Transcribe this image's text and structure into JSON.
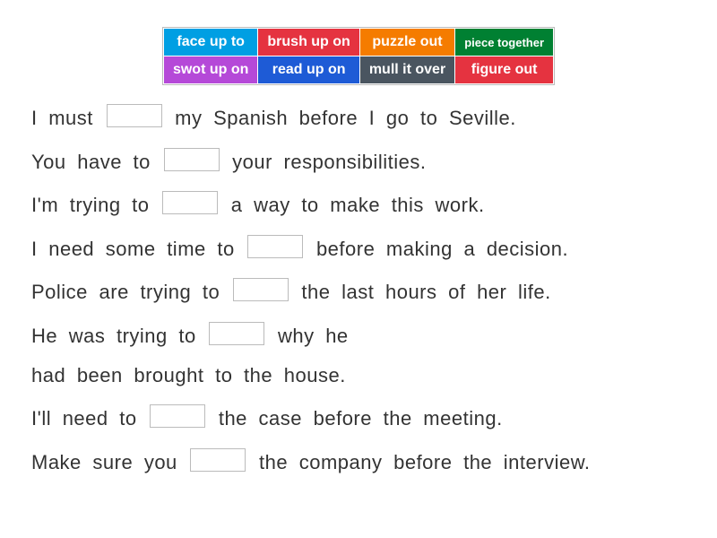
{
  "tiles": [
    {
      "label": "face up to",
      "bg": "#009fe3",
      "size": "normal"
    },
    {
      "label": "brush up on",
      "bg": "#e53340",
      "size": "normal"
    },
    {
      "label": "puzzle out",
      "bg": "#f57c00",
      "size": "normal"
    },
    {
      "label": "piece together",
      "bg": "#008032",
      "size": "small"
    },
    {
      "label": "swot up on",
      "bg": "#b549d8",
      "size": "normal"
    },
    {
      "label": "read up on",
      "bg": "#1e5bd6",
      "size": "normal"
    },
    {
      "label": "mull it over",
      "bg": "#4a5560",
      "size": "normal"
    },
    {
      "label": "figure out",
      "bg": "#e53340",
      "size": "normal"
    }
  ],
  "sentences": {
    "s1a": "I must ",
    "s1b": " my Spanish before I go to Seville.",
    "s2a": "You have to ",
    "s2b": " your responsibilities.",
    "s3a": "I'm trying to ",
    "s3b": " a way to make this work.",
    "s4a": "I need some time to ",
    "s4b": " before making a decision.",
    "s5a": "Police are trying to ",
    "s5b": " the last hours of her life.",
    "s6a": "He was trying to ",
    "s6b": " why he",
    "s6c": "had been brought to the house.",
    "s7a": "I'll need to ",
    "s7b": " the case before the meeting.",
    "s8a": "Make sure you ",
    "s8b": " the company before the interview."
  }
}
